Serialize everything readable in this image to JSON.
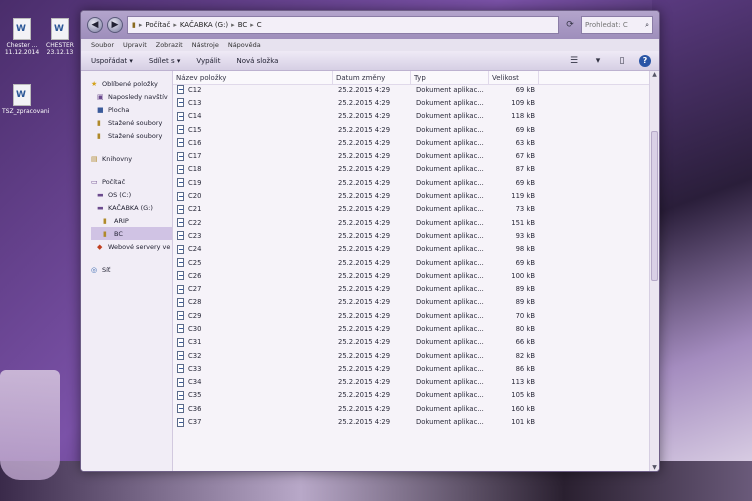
{
  "desktop": {
    "icons": [
      {
        "label": "Chester ... 11.12.2014"
      },
      {
        "label": "CHESTER 23.12.13"
      },
      {
        "label": "TSZ_zpracovani"
      }
    ]
  },
  "window": {
    "nav": {
      "back": "◀",
      "forward": "▶"
    },
    "address": [
      "Počítač",
      "KAČABKA (G:)",
      "BC",
      "C"
    ],
    "search_placeholder": "Prohledat: C",
    "menu": [
      "Soubor",
      "Upravit",
      "Zobrazit",
      "Nástroje",
      "Nápověda"
    ],
    "toolbar": {
      "organize": "Uspořádat ▾",
      "share": "Sdílet s ▾",
      "burn": "Vypálit",
      "new_folder": "Nová složka"
    },
    "sidebar": {
      "favorites": {
        "title": "Oblíbené položky",
        "items": [
          "Naposledy navštív",
          "Plocha",
          "Stažené soubory",
          "Stažené soubory"
        ]
      },
      "libraries": {
        "title": "Knihovny"
      },
      "computer": {
        "title": "Počítač",
        "items": [
          "OS (C:)",
          "KAČABKA (G:)",
          "ARIP",
          "BC",
          "Webové servery ve"
        ]
      },
      "network": {
        "title": "Síť"
      }
    },
    "columns": {
      "name": "Název položky",
      "date": "Datum změny",
      "type": "Typ",
      "size": "Velikost"
    },
    "files": [
      {
        "name": "C12",
        "date": "25.2.2015 4:29",
        "type": "Dokument aplikac...",
        "size": "69 kB"
      },
      {
        "name": "C13",
        "date": "25.2.2015 4:29",
        "type": "Dokument aplikac...",
        "size": "109 kB"
      },
      {
        "name": "C14",
        "date": "25.2.2015 4:29",
        "type": "Dokument aplikac...",
        "size": "118 kB"
      },
      {
        "name": "C15",
        "date": "25.2.2015 4:29",
        "type": "Dokument aplikac...",
        "size": "69 kB"
      },
      {
        "name": "C16",
        "date": "25.2.2015 4:29",
        "type": "Dokument aplikac...",
        "size": "63 kB"
      },
      {
        "name": "C17",
        "date": "25.2.2015 4:29",
        "type": "Dokument aplikac...",
        "size": "67 kB"
      },
      {
        "name": "C18",
        "date": "25.2.2015 4:29",
        "type": "Dokument aplikac...",
        "size": "87 kB"
      },
      {
        "name": "C19",
        "date": "25.2.2015 4:29",
        "type": "Dokument aplikac...",
        "size": "69 kB"
      },
      {
        "name": "C20",
        "date": "25.2.2015 4:29",
        "type": "Dokument aplikac...",
        "size": "119 kB"
      },
      {
        "name": "C21",
        "date": "25.2.2015 4:29",
        "type": "Dokument aplikac...",
        "size": "73 kB"
      },
      {
        "name": "C22",
        "date": "25.2.2015 4:29",
        "type": "Dokument aplikac...",
        "size": "151 kB"
      },
      {
        "name": "C23",
        "date": "25.2.2015 4:29",
        "type": "Dokument aplikac...",
        "size": "93 kB"
      },
      {
        "name": "C24",
        "date": "25.2.2015 4:29",
        "type": "Dokument aplikac...",
        "size": "98 kB"
      },
      {
        "name": "C25",
        "date": "25.2.2015 4:29",
        "type": "Dokument aplikac...",
        "size": "69 kB"
      },
      {
        "name": "C26",
        "date": "25.2.2015 4:29",
        "type": "Dokument aplikac...",
        "size": "100 kB"
      },
      {
        "name": "C27",
        "date": "25.2.2015 4:29",
        "type": "Dokument aplikac...",
        "size": "89 kB"
      },
      {
        "name": "C28",
        "date": "25.2.2015 4:29",
        "type": "Dokument aplikac...",
        "size": "89 kB"
      },
      {
        "name": "C29",
        "date": "25.2.2015 4:29",
        "type": "Dokument aplikac...",
        "size": "70 kB"
      },
      {
        "name": "C30",
        "date": "25.2.2015 4:29",
        "type": "Dokument aplikac...",
        "size": "80 kB"
      },
      {
        "name": "C31",
        "date": "25.2.2015 4:29",
        "type": "Dokument aplikac...",
        "size": "66 kB"
      },
      {
        "name": "C32",
        "date": "25.2.2015 4:29",
        "type": "Dokument aplikac...",
        "size": "82 kB"
      },
      {
        "name": "C33",
        "date": "25.2.2015 4:29",
        "type": "Dokument aplikac...",
        "size": "86 kB"
      },
      {
        "name": "C34",
        "date": "25.2.2015 4:29",
        "type": "Dokument aplikac...",
        "size": "113 kB"
      },
      {
        "name": "C35",
        "date": "25.2.2015 4:29",
        "type": "Dokument aplikac...",
        "size": "105 kB"
      },
      {
        "name": "C36",
        "date": "25.2.2015 4:29",
        "type": "Dokument aplikac...",
        "size": "160 kB"
      },
      {
        "name": "C37",
        "date": "25.2.2015 4:29",
        "type": "Dokument aplikac...",
        "size": "101 kB"
      }
    ]
  }
}
